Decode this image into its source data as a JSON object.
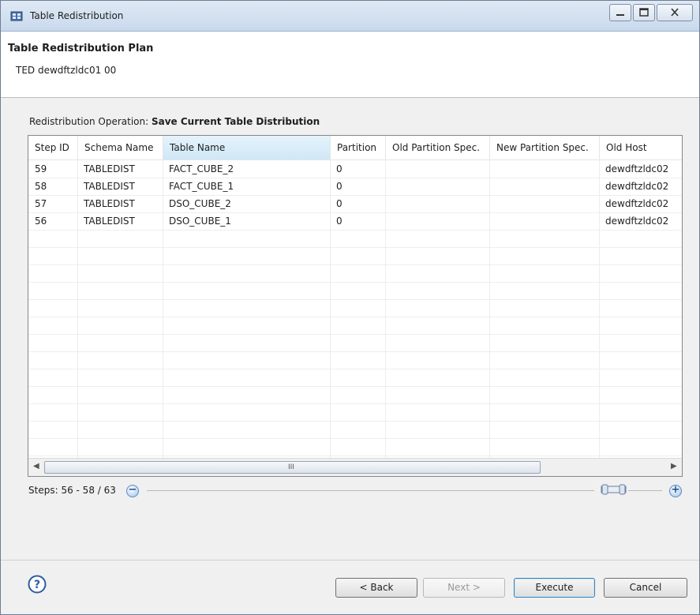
{
  "window": {
    "title": "Table Redistribution",
    "icon": "app-table-icon"
  },
  "header": {
    "title": "Table Redistribution Plan",
    "subtitle": "TED dewdftzldc01 00"
  },
  "operation": {
    "label": "Redistribution Operation:",
    "value": "Save Current Table Distribution"
  },
  "table": {
    "columns": [
      "Step ID",
      "Schema Name",
      "Table Name",
      "Partition",
      "Old Partition Spec.",
      "New Partition Spec.",
      "Old Host"
    ],
    "selected_column": "Table Name",
    "rows": [
      [
        "59",
        "TABLEDIST",
        "FACT_CUBE_2",
        "0",
        "",
        "",
        "dewdftzldc02"
      ],
      [
        "58",
        "TABLEDIST",
        "FACT_CUBE_1",
        "0",
        "",
        "",
        "dewdftzldc02"
      ],
      [
        "57",
        "TABLEDIST",
        "DSO_CUBE_2",
        "0",
        "",
        "",
        "dewdftzldc02"
      ],
      [
        "56",
        "TABLEDIST",
        "DSO_CUBE_1",
        "0",
        "",
        "",
        "dewdftzldc02"
      ]
    ],
    "scrollbar_grip": "III"
  },
  "steps": {
    "label": "Steps:",
    "value": "56 - 58 / 63"
  },
  "buttons": {
    "back": "< Back",
    "next": "Next >",
    "execute": "Execute",
    "cancel": "Cancel"
  }
}
